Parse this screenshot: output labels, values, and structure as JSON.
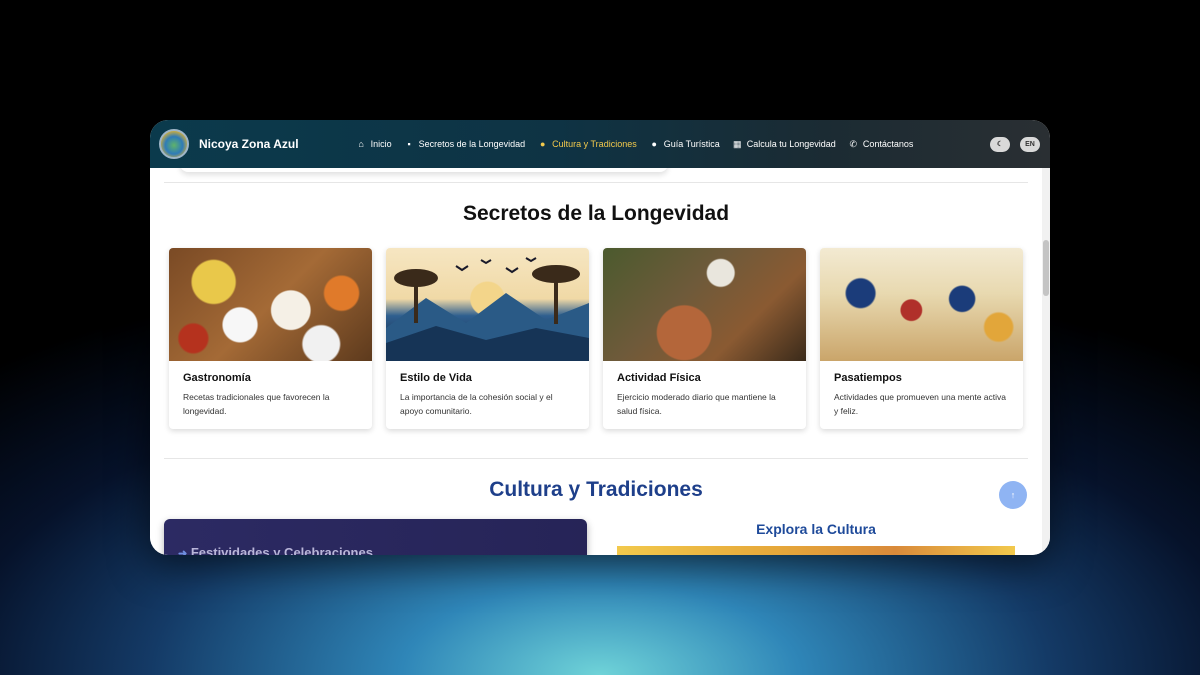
{
  "header": {
    "brand": "Nicoya Zona Azul",
    "nav": [
      {
        "label": "Inicio",
        "icon": "home-icon"
      },
      {
        "label": "Secretos de la Longevidad",
        "icon": "book-icon"
      },
      {
        "label": "Cultura y Tradiciones",
        "icon": "map-pin-icon",
        "active": true
      },
      {
        "label": "Guía Turística",
        "icon": "map-pin-icon"
      },
      {
        "label": "Calcula tu Longevidad",
        "icon": "calculator-icon"
      },
      {
        "label": "Contáctanos",
        "icon": "phone-icon"
      }
    ],
    "theme_toggle_icon": "moon-icon",
    "language": "EN"
  },
  "secretos": {
    "title": "Secretos de la Longevidad",
    "cards": [
      {
        "title": "Gastronomía",
        "desc": "Recetas tradicionales que favorecen la longevidad."
      },
      {
        "title": "Estilo de Vida",
        "desc": "La importancia de la cohesión social y el apoyo comunitario."
      },
      {
        "title": "Actividad Física",
        "desc": "Ejercicio moderado diario que mantiene la salud física."
      },
      {
        "title": "Pasatiempos",
        "desc": "Actividades que promueven una mente activa y feliz."
      }
    ]
  },
  "cultura": {
    "title": "Cultura y Tradiciones",
    "festival_label": "Festividades y Celebraciones",
    "explora_title": "Explora la Cultura"
  },
  "colors": {
    "accent": "#f2c94c",
    "section_blue": "#1e3f8a"
  }
}
